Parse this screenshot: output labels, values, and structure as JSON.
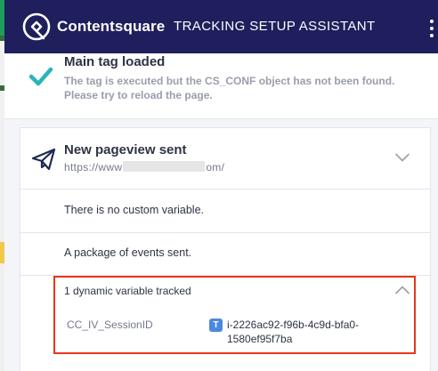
{
  "header": {
    "brand": "Contentsquare",
    "title": "TRACKING SETUP ASSISTANT",
    "logo_icon": "contentsquare-logo-icon",
    "menu_icon": "kebab-menu-icon",
    "background": "#1e1f5c"
  },
  "main_tag": {
    "title": "Main tag loaded",
    "description": "The tag is executed but the CS_CONF object has not been found. Please try to reload the page.",
    "status_icon": "checkmark-icon",
    "status_color": "#2bb5b8"
  },
  "pageview": {
    "title": "New pageview sent",
    "url_prefix": "https://www",
    "url_suffix": "om/",
    "icon": "paper-plane-icon",
    "toggle_icon": "chevron-down-icon",
    "rows": [
      {
        "text": "There is no custom variable."
      },
      {
        "text": "A package of events sent."
      }
    ]
  },
  "dynamic_variables": {
    "title": "1 dynamic variable tracked",
    "toggle_icon": "chevron-up-icon",
    "highlight_color": "#e8361e",
    "items": [
      {
        "name": "CC_IV_SessionID",
        "type_badge": "T",
        "value": "i-2226ac92-f96b-4c9d-bfa0-1580ef95f7ba"
      }
    ]
  }
}
